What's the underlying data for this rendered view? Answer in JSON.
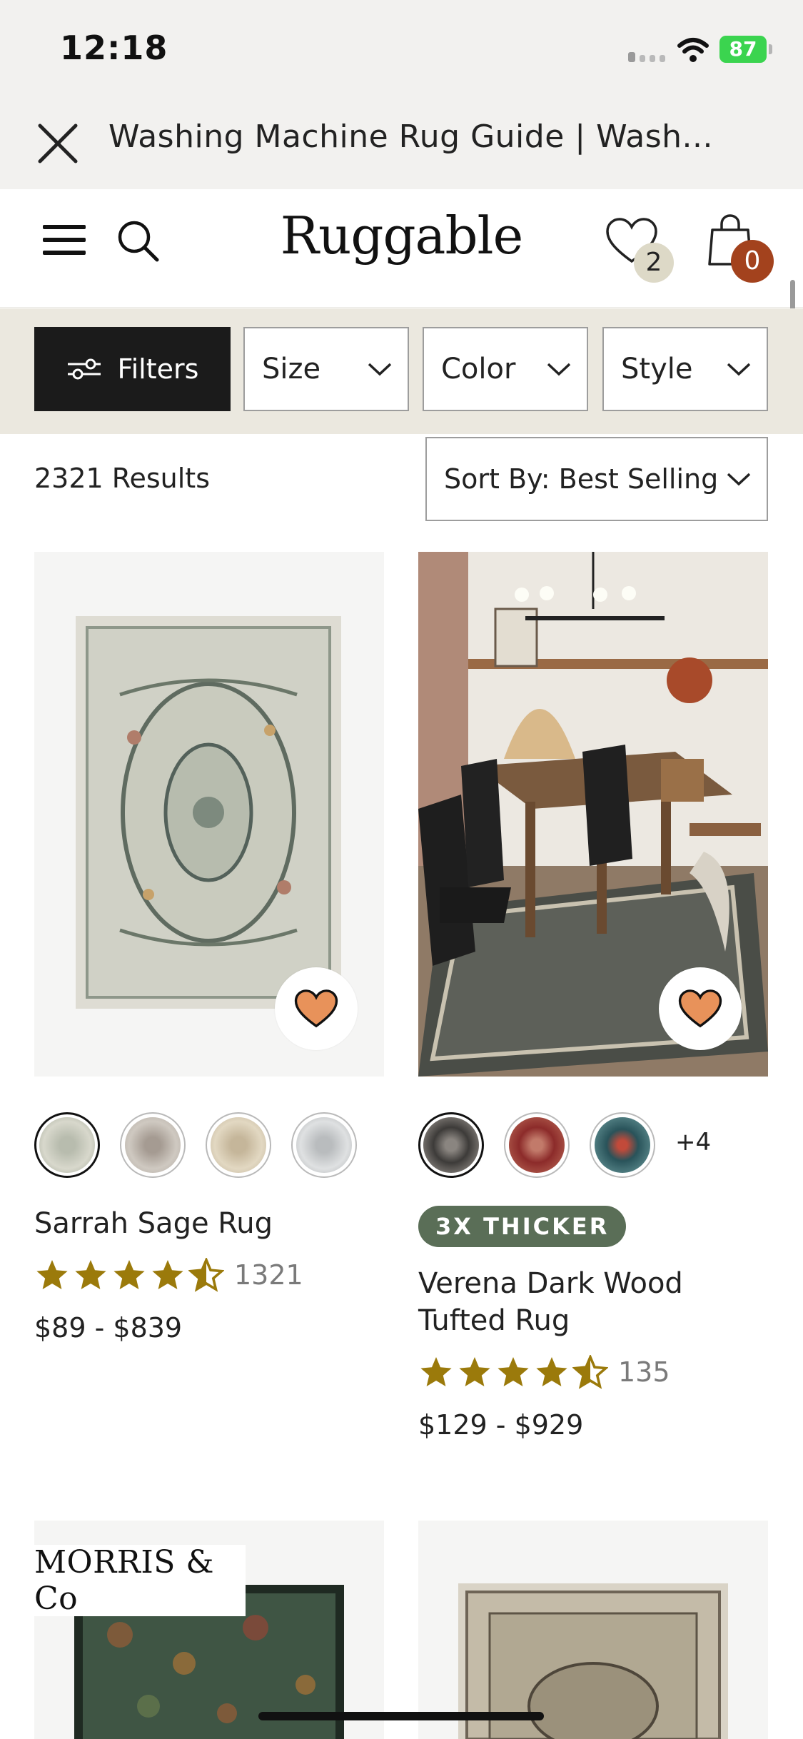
{
  "status_bar": {
    "time": "12:18",
    "battery": "87"
  },
  "browser": {
    "title": "Washing Machine Rug Guide | Wash..."
  },
  "site_header": {
    "logo": "Ruggable",
    "wishlist_count": "2",
    "cart_count": "0"
  },
  "filters": {
    "filters_label": "Filters",
    "dropdowns": [
      {
        "label": "Size"
      },
      {
        "label": "Color"
      },
      {
        "label": "Style"
      }
    ]
  },
  "results": {
    "count_text": "2321 Results",
    "sort_label": "Sort By: Best Selling"
  },
  "products": [
    {
      "name": "Sarrah Sage Rug",
      "rating": 4.5,
      "review_count": "1321",
      "price": "$89 - $839",
      "swatches": [
        "#c9ccbc",
        "#c2bcb4",
        "#d6cbb2",
        "#cfd2d3"
      ],
      "selected_swatch": 0
    },
    {
      "name": "Verena Dark Wood Tufted Rug",
      "badge": "3X THICKER",
      "rating": 4.5,
      "review_count": "135",
      "price": "$129 - $929",
      "swatches": [
        "#3d3b39",
        "#8c2b2a",
        "#29535a"
      ],
      "selected_swatch": 0,
      "more_colors": "+4"
    },
    {
      "brand_tag": "MORRIS & Co"
    },
    {}
  ],
  "colors": {
    "accent_heart": "#e8925a",
    "star": "#9b7a0b",
    "badge": "#5a6e57",
    "cart_badge": "#a3421d"
  }
}
